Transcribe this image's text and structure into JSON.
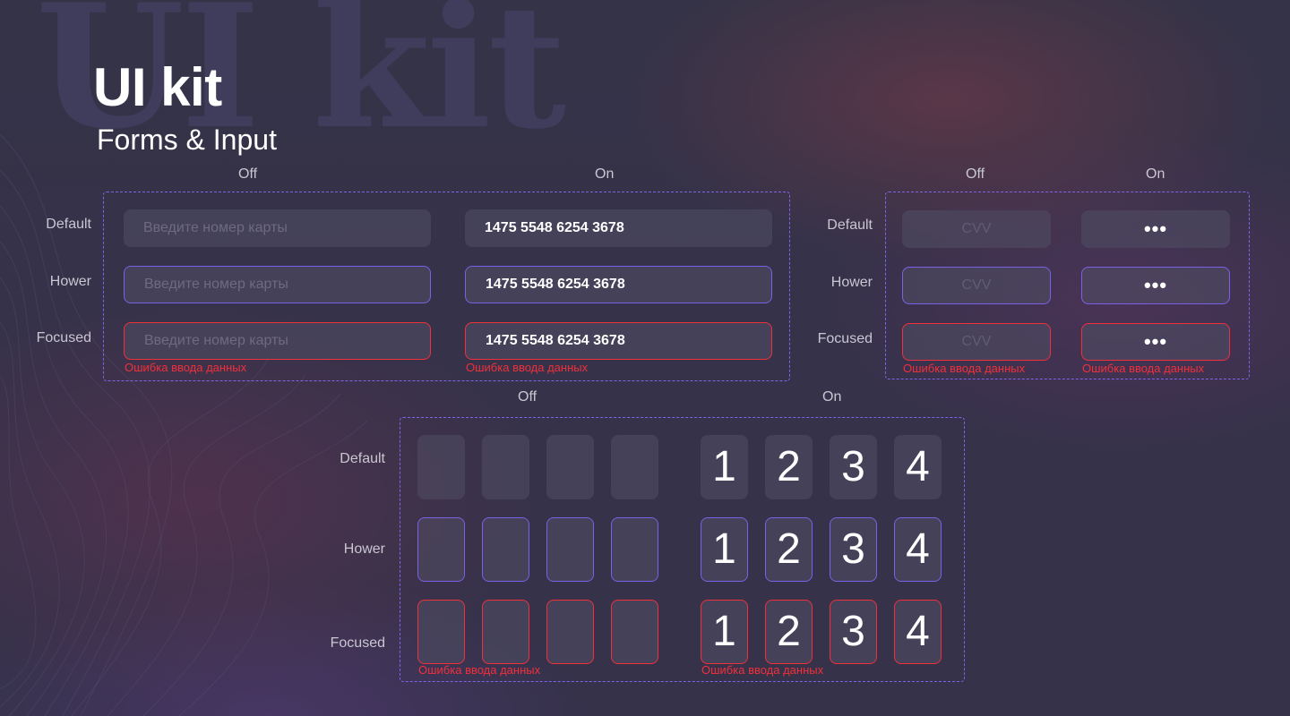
{
  "header": {
    "ghost_text": "UI kit",
    "title": "UI kit",
    "subtitle": "Forms & Input"
  },
  "card_section": {
    "col_off": "Off",
    "col_on": "On",
    "rows": [
      "Default",
      "Hower",
      "Focused"
    ],
    "placeholder": "Введите номер карты",
    "value": "1475 5548 6254 3678",
    "error": "Ошибка ввода данных"
  },
  "cvv_section": {
    "col_off": "Off",
    "col_on": "On",
    "rows": [
      "Default",
      "Hower",
      "Focused"
    ],
    "placeholder": "CVV",
    "value": "•••",
    "error": "Ошибка ввода данных"
  },
  "pin_section": {
    "col_off": "Off",
    "col_on": "On",
    "rows": [
      "Default",
      "Hower",
      "Focused"
    ],
    "digits": [
      "1",
      "2",
      "3",
      "4"
    ],
    "error": "Ошибка ввода данных"
  },
  "colors": {
    "accent": "#7f63e8",
    "error": "#f0303a",
    "background": "#35324a"
  }
}
